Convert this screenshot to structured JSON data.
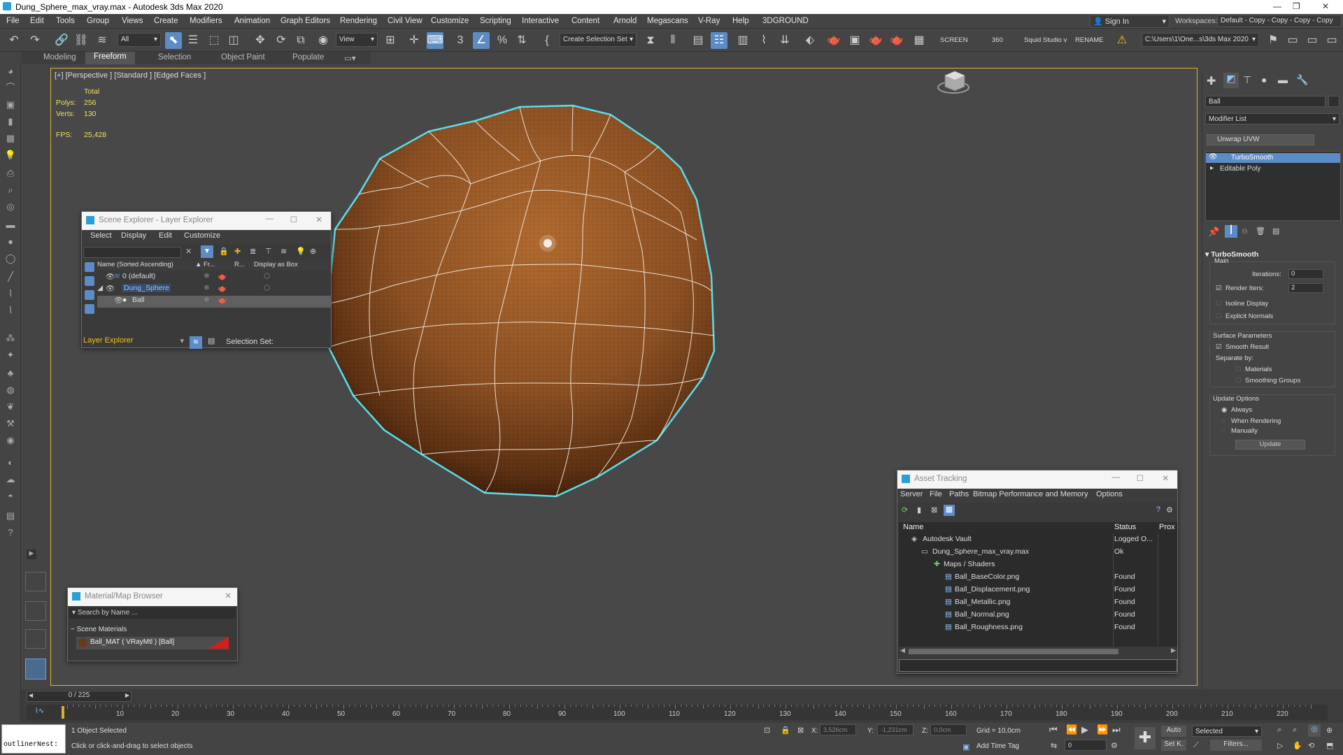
{
  "window": {
    "title": "Dung_Sphere_max_vray.max - Autodesk 3ds Max 2020",
    "controls": [
      "—",
      "❐",
      "✕"
    ]
  },
  "menu": [
    "File",
    "Edit",
    "Tools",
    "Group",
    "Views",
    "Create",
    "Modifiers",
    "Animation",
    "Graph Editors",
    "Rendering",
    "Civil View",
    "Customize",
    "Scripting",
    "Interactive",
    "Content",
    "Arnold",
    "Megascans",
    "V-Ray",
    "Help",
    "3DGROUND"
  ],
  "signin": "Sign In",
  "workspaces": {
    "label": "Workspaces:",
    "value": "Default - Copy - Copy - Copy - Copy"
  },
  "toolbar": {
    "filter": "All",
    "refcoord": "View",
    "selset": "Create Selection Set",
    "screen": "SCREEN",
    "deg": "360",
    "studio": "Squid Studio v",
    "rename": "RENAME",
    "path": "C:\\Users\\1\\One...s\\3ds Max 2020"
  },
  "ribbon": [
    "Modeling",
    "Freeform",
    "Selection",
    "Object Paint",
    "Populate"
  ],
  "viewport": {
    "label": "[+] [Perspective ] [Standard ] [Edged Faces ]",
    "total": "Total",
    "polys_label": "Polys:",
    "polys": "256",
    "verts_label": "Verts:",
    "verts": "130",
    "fps_label": "FPS:",
    "fps": "25,428"
  },
  "scene_explorer": {
    "title": "Scene Explorer - Layer Explorer",
    "menu": [
      "Select",
      "Display",
      "Edit",
      "Customize"
    ],
    "col_name": "Name (Sorted Ascending)",
    "col_fr": "▲ Fr...",
    "col_r": "R...",
    "col_box": "Display as Box",
    "rows": [
      {
        "name": "0 (default)"
      },
      {
        "name": "Dung_Sphere"
      },
      {
        "name": "Ball"
      }
    ],
    "footer": "Layer Explorer",
    "selset": "Selection Set:"
  },
  "material_browser": {
    "title": "Material/Map Browser",
    "search": "Search by Name ...",
    "group": "Scene Materials",
    "item": "Ball_MAT  ( VRayMtl )  [Ball]"
  },
  "asset_tracking": {
    "title": "Asset Tracking",
    "menu": [
      "Server",
      "File",
      "Paths",
      "Bitmap Performance and Memory",
      "Options"
    ],
    "col_name": "Name",
    "col_status": "Status",
    "col_prox": "Prox",
    "rows": [
      {
        "name": "Autodesk Vault",
        "status": "Logged O..."
      },
      {
        "name": "Dung_Sphere_max_vray.max",
        "status": "Ok"
      },
      {
        "name": "Maps / Shaders",
        "status": ""
      },
      {
        "name": "Ball_BaseColor.png",
        "status": "Found"
      },
      {
        "name": "Ball_Displacement.png",
        "status": "Found"
      },
      {
        "name": "Ball_Metallic.png",
        "status": "Found"
      },
      {
        "name": "Ball_Normal.png",
        "status": "Found"
      },
      {
        "name": "Ball_Roughness.png",
        "status": "Found"
      }
    ]
  },
  "modify_panel": {
    "object_name": "Ball",
    "modifier_list": "Modifier List",
    "unwrap": "Unwrap UVW",
    "stack": [
      "TurboSmooth",
      "Editable Poly"
    ],
    "rollout": "TurboSmooth",
    "main": "Main",
    "iterations_label": "Iterations:",
    "iterations": "0",
    "render_iters_label": "Render Iters:",
    "render_iters": "2",
    "isoline": "Isoline Display",
    "explicit": "Explicit Normals",
    "surface": "Surface Parameters",
    "smooth_result": "Smooth Result",
    "separate": "Separate by:",
    "materials": "Materials",
    "smoothing": "Smoothing Groups",
    "update_opts": "Update Options",
    "always": "Always",
    "when_render": "When Rendering",
    "manually": "Manually",
    "update_btn": "Update"
  },
  "timeline": {
    "frame": "0 / 225",
    "ticks": [
      "10",
      "20",
      "30",
      "40",
      "50",
      "60",
      "70",
      "80",
      "90",
      "100",
      "110",
      "120",
      "130",
      "140",
      "150",
      "160",
      "170",
      "180",
      "190",
      "200",
      "210",
      "220"
    ]
  },
  "status": {
    "outliner": "outlinerNest:",
    "selected": "1 Object Selected",
    "hint": "Click or click-and-drag to select objects",
    "x_label": "X:",
    "x": "3,526cm",
    "y_label": "Y:",
    "y": "-1,231cm",
    "z_label": "Z:",
    "z": "0,0cm",
    "grid": "Grid = 10,0cm",
    "add_tag": "Add Time Tag",
    "auto": "Auto",
    "set_key": "Set K.",
    "sel_dd": "Selected",
    "filters": "Filters...",
    "frame_field": "0"
  },
  "colors": {
    "accent": "#5b8cc6",
    "viewport_border": "#d8b035",
    "selection_wire": "#55e0f0",
    "sphere": "#8a4f22"
  }
}
